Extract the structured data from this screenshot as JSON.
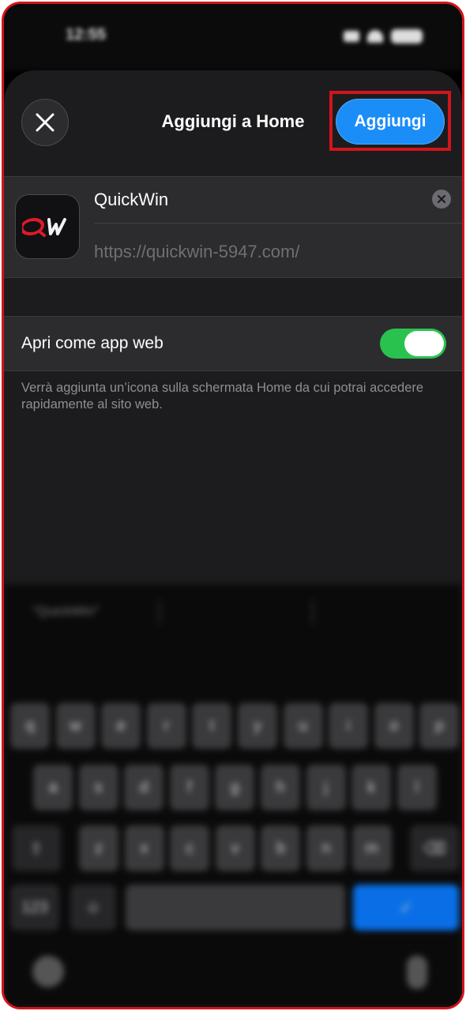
{
  "sheet": {
    "title": "Aggiungi a Home",
    "add_label": "Aggiungi"
  },
  "app": {
    "name": "QuickWin",
    "url": "https://quickwin-5947.com/",
    "icon_text": "QW"
  },
  "webapp": {
    "label": "Apri come app web",
    "enabled": true,
    "hint": "Verrà aggiunta un’icona sulla schermata Home da cui potrai accedere rapidamente al sito web."
  },
  "keyboard": {
    "suggestion": "“QuickWin”",
    "row1": [
      "q",
      "w",
      "e",
      "r",
      "t",
      "y",
      "u",
      "i",
      "o",
      "p"
    ],
    "row2": [
      "a",
      "s",
      "d",
      "f",
      "g",
      "h",
      "j",
      "k",
      "l"
    ],
    "row3": [
      "z",
      "x",
      "c",
      "v",
      "b",
      "n",
      "m"
    ],
    "numbers_label": "123",
    "return_label": "✓"
  },
  "colors": {
    "accent": "#1a8df7",
    "toggle_on": "#2ac24f",
    "highlight": "#d2141b"
  }
}
